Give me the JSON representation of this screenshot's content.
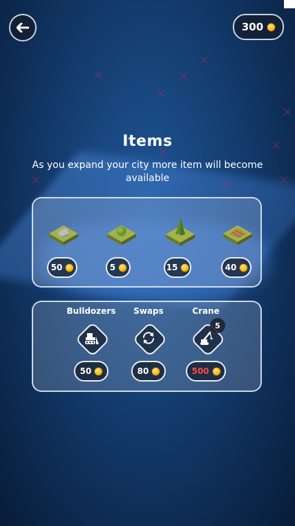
{
  "header": {
    "coins": "300"
  },
  "title": "Items",
  "subtitle": "As you expand your city more item will become available",
  "items": [
    {
      "name": "rock-tile",
      "price": "50"
    },
    {
      "name": "bush-tile",
      "price": "5"
    },
    {
      "name": "tree-tile",
      "price": "15"
    },
    {
      "name": "field-tile",
      "price": "40"
    }
  ],
  "tools": [
    {
      "label": "Bulldozers",
      "price": "50",
      "icon": "bulldozer-icon"
    },
    {
      "label": "Swaps",
      "price": "80",
      "icon": "swap-icon"
    },
    {
      "label": "Crane",
      "price": "500",
      "icon": "crane-icon",
      "count": "5",
      "price_color": "#ff4b4b"
    }
  ],
  "colors": {
    "coin": "#f0b000",
    "panel_border": "#e6eefa",
    "background": "#153f73"
  }
}
